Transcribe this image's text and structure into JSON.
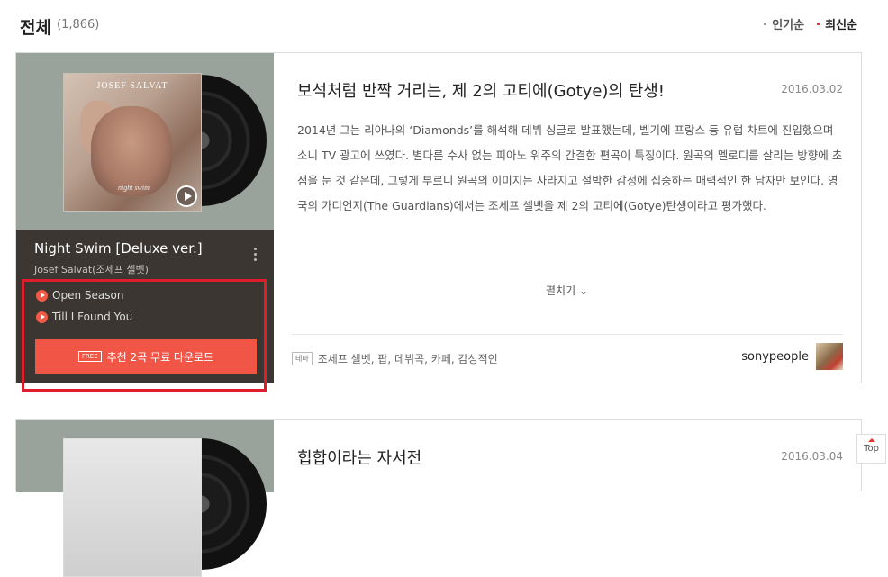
{
  "header": {
    "title": "전체",
    "count": "(1,866)",
    "sort": [
      "인기순",
      "최신순"
    ]
  },
  "post1": {
    "album": "Night Swim [Deluxe ver.]",
    "artist": "Josef Salvat(조세프 셀벳)",
    "cover_text": "JOSEF SALVAT",
    "cover_subtext": "night swim",
    "tracks": [
      "Open Season",
      "Till I Found You"
    ],
    "free_badge": "FREE",
    "download_label": "추천 2곡 무료 다운로드",
    "title": "보석처럼 반짝 거리는, 제 2의 고티에(Gotye)의 탄생!",
    "date": "2016.03.02",
    "body": "2014년 그는 리아나의 ‘Diamonds’를 해석해 데뷔 싱글로 발표했는데, 벨기에 프랑스 등 유럽 차트에 진입했으며 소니 TV 광고에 쓰였다. 별다른 수사 없는 피아노 위주의 간결한 편곡이 특징이다. 원곡의 멜로디를 살리는 방향에 초점을 둔 것 같은데, 그렇게 부르니 원곡의 이미지는 사라지고 절박한 감정에 집중하는 매력적인 한 남자만 보인다. 영국의 가디언지(The Guardians)에서는 조세프 셀벳을 제 2의 고티에(Gotye)탄생이라고 평가했다.",
    "expand_label": "펼치기",
    "tag_badge": "테마",
    "tags": "조세프 셀벳, 팝, 데뷔곡, 카페, 감성적인",
    "author": "sonypeople"
  },
  "post2": {
    "title": "힙합이라는 자서전",
    "date": "2016.03.04"
  },
  "top_label": "Top",
  "colors": {
    "accent": "#f05545",
    "highlight": "#e01d2a",
    "sidebar": "#3b3632"
  }
}
